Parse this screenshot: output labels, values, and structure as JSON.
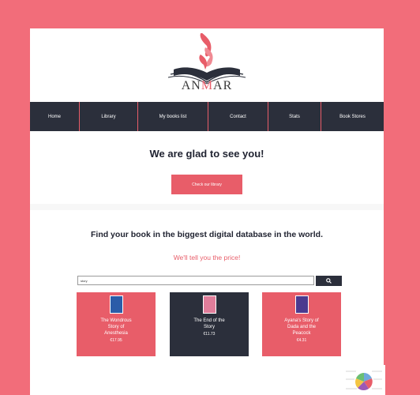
{
  "brand": {
    "name_left": "AN",
    "name_mid": "M",
    "name_right": "AR"
  },
  "nav": {
    "items": [
      "Home",
      "Library",
      "My books list",
      "Contact",
      "Stats",
      "Book Stores"
    ]
  },
  "hero": {
    "title": "We are glad to see you!",
    "cta_label": "Check our library"
  },
  "search_section": {
    "heading": "Find your book in the biggest digital database in the world.",
    "subheading": "We'll tell you the price!",
    "input_value": "story"
  },
  "books": [
    {
      "title": "The Wondrous Story of Anesthesia",
      "price": "€17.95",
      "theme": "red",
      "cover_color": "#2b5ca8"
    },
    {
      "title": "The End of the Story",
      "price": "€11.73",
      "theme": "dark",
      "cover_color": "#e07d9a"
    },
    {
      "title": "Ayana's Story of Dada and the Peacock",
      "price": "€4.31",
      "theme": "red",
      "cover_color": "#4b3a8f"
    }
  ],
  "colors": {
    "accent": "#e85d69",
    "dark": "#2b2f3b",
    "background": "#f26d7a"
  },
  "icons": {
    "search": "search-icon",
    "logo": "open-book-flame-icon"
  }
}
